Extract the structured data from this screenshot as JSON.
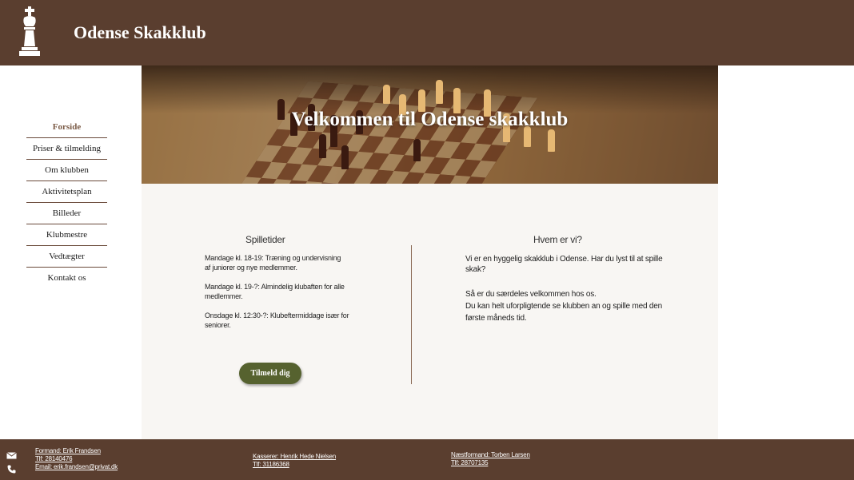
{
  "header": {
    "site_title": "Odense Skakklub"
  },
  "nav": {
    "items": [
      {
        "label": "Forside"
      },
      {
        "label": "Priser & tilmelding"
      },
      {
        "label": "Om klubben"
      },
      {
        "label": "Aktivitetsplan"
      },
      {
        "label": "Billeder"
      },
      {
        "label": "Klubmestre"
      },
      {
        "label": "Vedtægter"
      },
      {
        "label": "Kontakt os"
      }
    ]
  },
  "hero": {
    "title": "Velkommen til Odense skakklub"
  },
  "left": {
    "title": "Spilletider",
    "p1_line1": "Mandage kl. 18-19: Træning og undervisning",
    "p1_line2": "af juniorer og nye medlemmer.",
    "p2_line1": "Mandage kl. 19-?: Almindelig klubaften for alle",
    "p2_line2": "medlemmer.",
    "p3_line1": "Onsdage kl. 12:30-?: Klubeftermiddage især for",
    "p3_line2": "seniorer.",
    "button_label": "Tilmeld dig"
  },
  "right": {
    "title": "Hvem er vi?",
    "p1_line1": "Vi er en hyggelig skakklub i Odense. Har du lyst til at spille",
    "p1_line2": "skak?",
    "p2_line1": "Så er du særdeles velkommen hos os.",
    "p2_line2": "Du kan helt uforpligtende se klubben an og spille med den",
    "p2_line3": "første måneds tid."
  },
  "footer": {
    "formand_name": "Formand: Erik Frandsen",
    "formand_phone": "Tlf: 28140476",
    "formand_email": "Email: erik.frandsen@privat.dk",
    "kasserer_name": "Kasserer: Henrik Hede Nielsen",
    "kasserer_phone": "Tlf: 31186368",
    "naestformand_name": "Næstformand: Torben Larsen",
    "naestformand_phone": "Tlf: 28707135"
  }
}
